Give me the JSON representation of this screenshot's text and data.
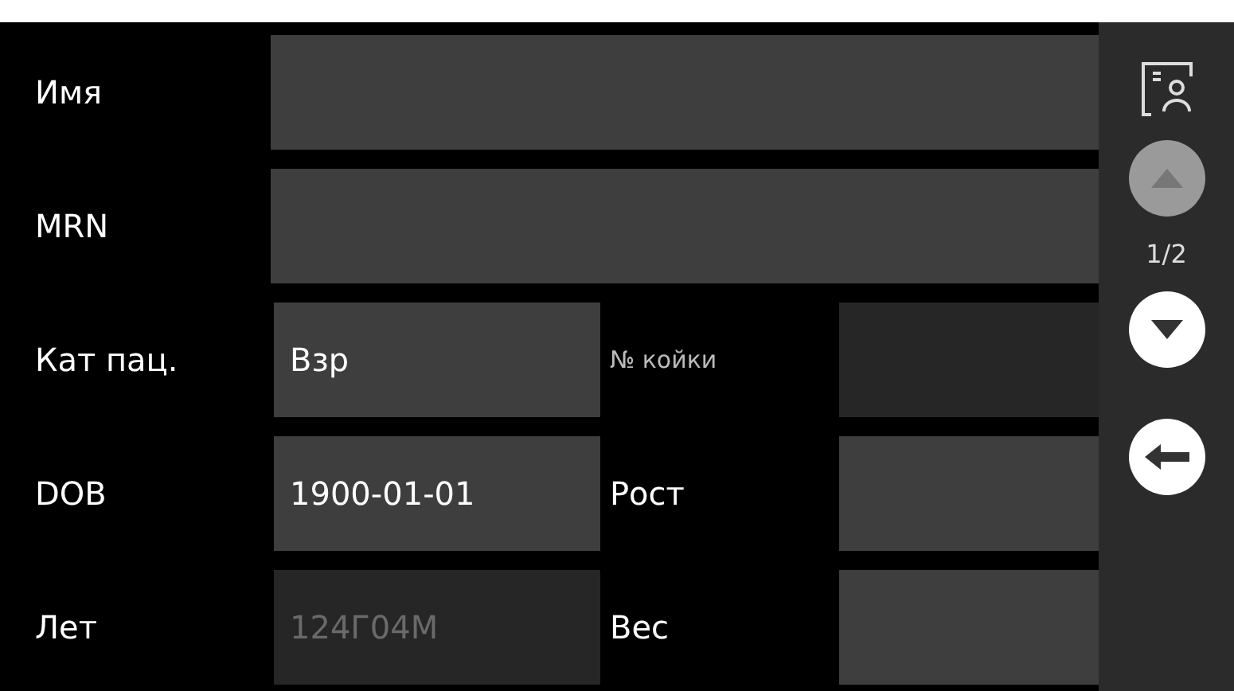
{
  "rows": [
    {
      "kind": "wide",
      "label": "Имя"
    },
    {
      "kind": "wide",
      "label": "MRN"
    },
    {
      "kind": "pair",
      "cells": [
        {
          "label": "Кат пац.",
          "value": "Взр",
          "disabled": false
        },
        {
          "label": "№ койки",
          "disabled": true
        }
      ]
    },
    {
      "kind": "pair",
      "cells": [
        {
          "label": "DOB",
          "value": "1900-01-01",
          "disabled": false
        },
        {
          "label": "Рост",
          "disabled": false
        }
      ]
    },
    {
      "kind": "pair",
      "cells": [
        {
          "label": "Лет",
          "value": "124Г04М",
          "disabled": true
        },
        {
          "label": "Вес",
          "disabled": false
        }
      ]
    }
  ],
  "sidebar": {
    "page": "1/2",
    "page_up_disabled": true,
    "page_down_disabled": false
  }
}
